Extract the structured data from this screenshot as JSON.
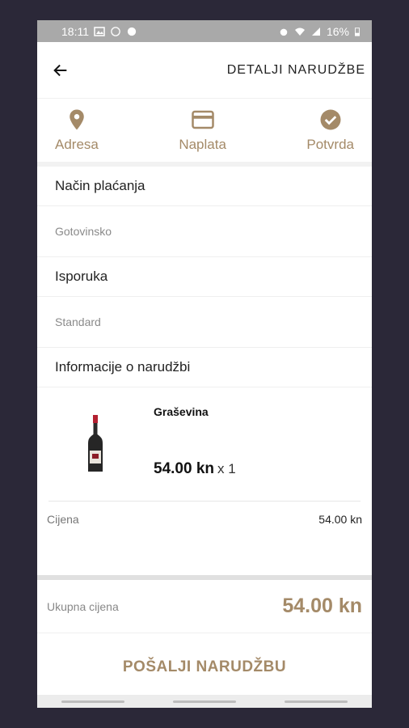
{
  "status_bar": {
    "time": "18:11",
    "battery": "16%"
  },
  "header": {
    "title": "DETALJI NARUDŽBE",
    "back_icon": "arrow-left-icon"
  },
  "steps": [
    {
      "label": "Adresa",
      "icon": "location-pin-icon"
    },
    {
      "label": "Naplata",
      "icon": "credit-card-icon"
    },
    {
      "label": "Potvrda",
      "icon": "check-circle-icon"
    }
  ],
  "payment": {
    "heading": "Način plaćanja",
    "value": "Gotovinsko"
  },
  "delivery": {
    "heading": "Isporuka",
    "value": "Standard"
  },
  "order_info": {
    "heading": "Informacije o narudžbi"
  },
  "product": {
    "name": "Graševina",
    "price": "54.00 kn",
    "quantity": "x 1"
  },
  "price_row": {
    "label": "Cijena",
    "value": "54.00 kn"
  },
  "total": {
    "label": "Ukupna cijena",
    "value": "54.00 kn"
  },
  "submit_label": "POŠALJI NARUDŽBU",
  "colors": {
    "accent": "#a48a68",
    "background": "#2b2838",
    "status_bar": "#a9a9a9"
  }
}
